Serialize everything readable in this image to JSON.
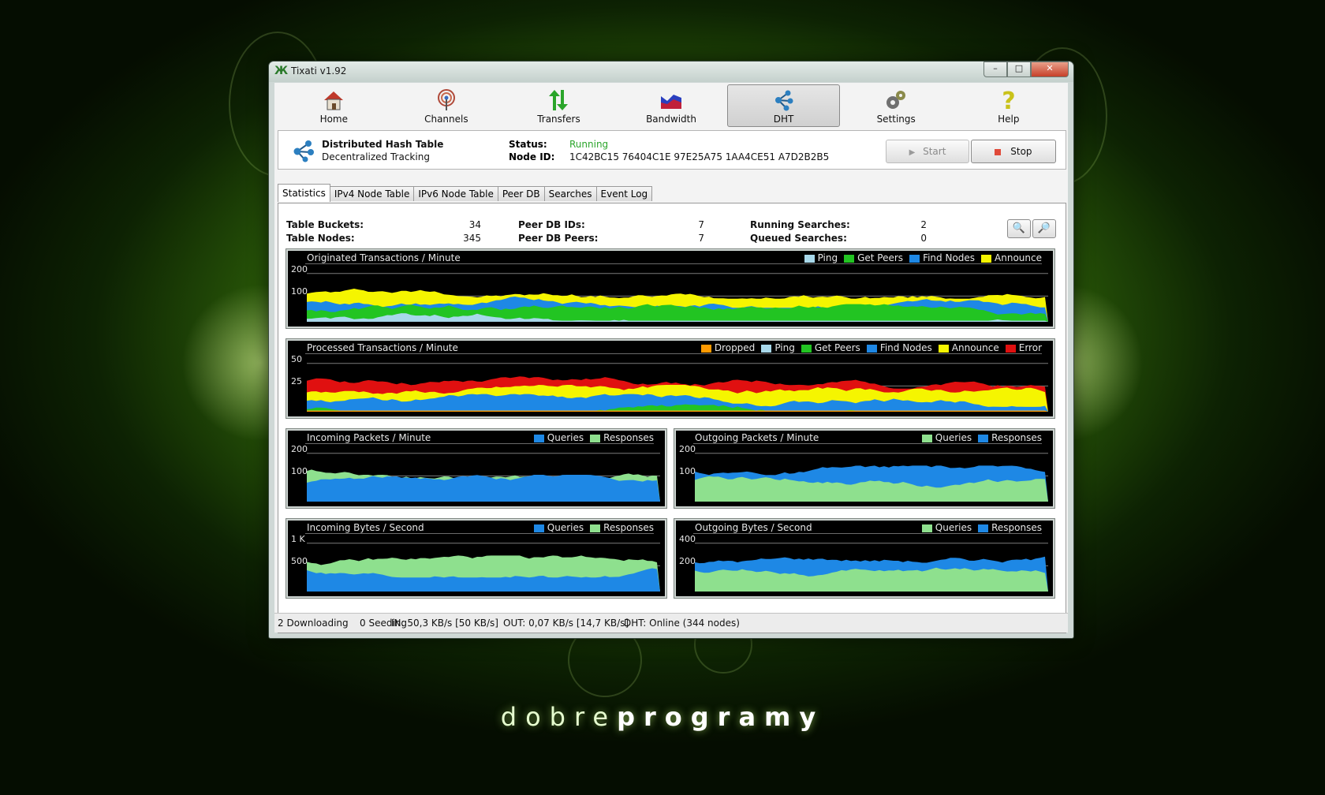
{
  "window": {
    "title": "Tixati v1.92",
    "min": "–",
    "max": "□",
    "close": "✕"
  },
  "toolbar": [
    {
      "id": "home",
      "label": "Home",
      "icon": "house-icon"
    },
    {
      "id": "channels",
      "label": "Channels",
      "icon": "antenna-icon"
    },
    {
      "id": "transfers",
      "label": "Transfers",
      "icon": "updown-arrows-icon"
    },
    {
      "id": "bandwidth",
      "label": "Bandwidth",
      "icon": "bandwidth-graph-icon"
    },
    {
      "id": "dht",
      "label": "DHT",
      "icon": "network-nodes-icon",
      "active": true
    },
    {
      "id": "settings",
      "label": "Settings",
      "icon": "gears-icon"
    },
    {
      "id": "help",
      "label": "Help",
      "icon": "question-mark-icon"
    }
  ],
  "info": {
    "title": "Distributed Hash Table",
    "subtitle": "Decentralized Tracking",
    "status_label": "Status:",
    "status_value": "Running",
    "nodeid_label": "Node ID:",
    "nodeid_value": "1C42BC15 76404C1E 97E25A75 1AA4CE51 A7D2B2B5",
    "start_label": "Start",
    "stop_label": "Stop"
  },
  "tabs": [
    "Statistics",
    "IPv4 Node Table",
    "IPv6 Node Table",
    "Peer DB",
    "Searches",
    "Event Log"
  ],
  "stats": {
    "table_buckets_label": "Table Buckets:",
    "table_buckets": "34",
    "table_nodes_label": "Table Nodes:",
    "table_nodes": "345",
    "peer_db_ids_label": "Peer DB IDs:",
    "peer_db_ids": "7",
    "peer_db_peers_label": "Peer DB Peers:",
    "peer_db_peers": "7",
    "running_searches_label": "Running Searches:",
    "running_searches": "2",
    "queued_searches_label": "Queued Searches:",
    "queued_searches": "0"
  },
  "graphs": {
    "originated": {
      "title": "Originated Transactions / Minute",
      "ticks": [
        "200",
        "100"
      ],
      "legend": [
        [
          "Ping",
          "#a8d8ea"
        ],
        [
          "Get Peers",
          "#22c422"
        ],
        [
          "Find Nodes",
          "#1e88e5"
        ],
        [
          "Announce",
          "#f5f500"
        ]
      ]
    },
    "processed": {
      "title": "Processed Transactions / Minute",
      "ticks": [
        "50",
        "25"
      ],
      "legend": [
        [
          "Dropped",
          "#ff9a00"
        ],
        [
          "Ping",
          "#a8d8ea"
        ],
        [
          "Get Peers",
          "#22c422"
        ],
        [
          "Find Nodes",
          "#1e88e5"
        ],
        [
          "Announce",
          "#f5f500"
        ],
        [
          "Error",
          "#e01010"
        ]
      ]
    },
    "in_packets": {
      "title": "Incoming Packets / Minute",
      "ticks": [
        "200",
        "100"
      ],
      "legend": [
        [
          "Queries",
          "#1e88e5"
        ],
        [
          "Responses",
          "#8ee08e"
        ]
      ]
    },
    "out_packets": {
      "title": "Outgoing Packets / Minute",
      "ticks": [
        "200",
        "100"
      ],
      "legend": [
        [
          "Queries",
          "#8ee08e"
        ],
        [
          "Responses",
          "#1e88e5"
        ]
      ]
    },
    "in_bytes": {
      "title": "Incoming Bytes / Second",
      "ticks": [
        "1 K",
        "500"
      ],
      "legend": [
        [
          "Queries",
          "#1e88e5"
        ],
        [
          "Responses",
          "#8ee08e"
        ]
      ]
    },
    "out_bytes": {
      "title": "Outgoing Bytes / Second",
      "ticks": [
        "400",
        "200"
      ],
      "legend": [
        [
          "Queries",
          "#8ee08e"
        ],
        [
          "Responses",
          "#1e88e5"
        ]
      ]
    }
  },
  "statusbar": {
    "downloading": "2 Downloading",
    "seeding": "0 Seeding",
    "in": "IN: 50,3 KB/s [50 KB/s]",
    "out": "OUT: 0,07 KB/s [14,7 KB/s]",
    "dht": "DHT: Online (344 nodes)"
  },
  "brand": {
    "light": "dobre",
    "bold": "programy"
  }
}
